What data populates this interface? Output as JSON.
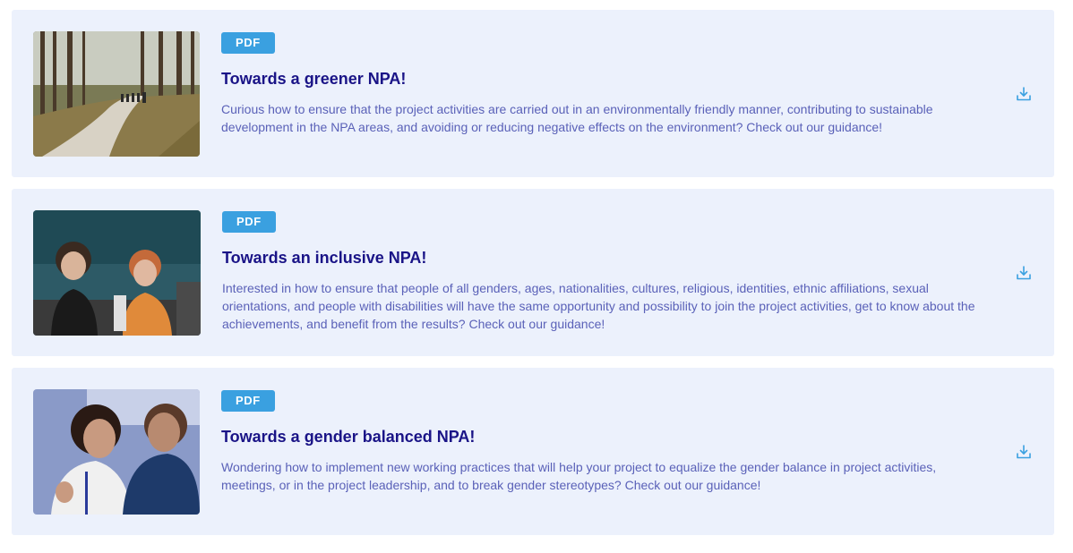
{
  "documents": [
    {
      "badge": "PDF",
      "title": "Towards a greener NPA!",
      "description": "Curious how to ensure that the project activities are carried out in an environmentally friendly manner, contributing to sustainable development in the NPA areas, and avoiding or reducing negative effects on the environment? Check out our guidance!",
      "image": "forest-road-cyclists",
      "icon": "download-icon"
    },
    {
      "badge": "PDF",
      "title": "Towards an inclusive NPA!",
      "description": "Interested in how to ensure that people of all genders, ages, nationalities, cultures, religious, identities, ethnic affiliations, sexual orientations, and people with disabilities will have the same opportunity and possibility to join the project activities, get to know about the achievements, and benefit from the results? Check out our guidance!",
      "image": "conference-attendees",
      "icon": "download-icon"
    },
    {
      "badge": "PDF",
      "title": "Towards a gender balanced NPA!",
      "description": "Wondering how to implement new working practices that will help your project to equalize the gender balance in project activities, meetings, or in the project leadership, and to break gender stereotypes? Check out our guidance!",
      "image": "conversation-people",
      "icon": "download-icon"
    }
  ],
  "colors": {
    "card_bg": "#ecf1fc",
    "badge_bg": "#3aa0e0",
    "title": "#1a1487",
    "text": "#5a61b8",
    "icon": "#3aa0e0"
  }
}
